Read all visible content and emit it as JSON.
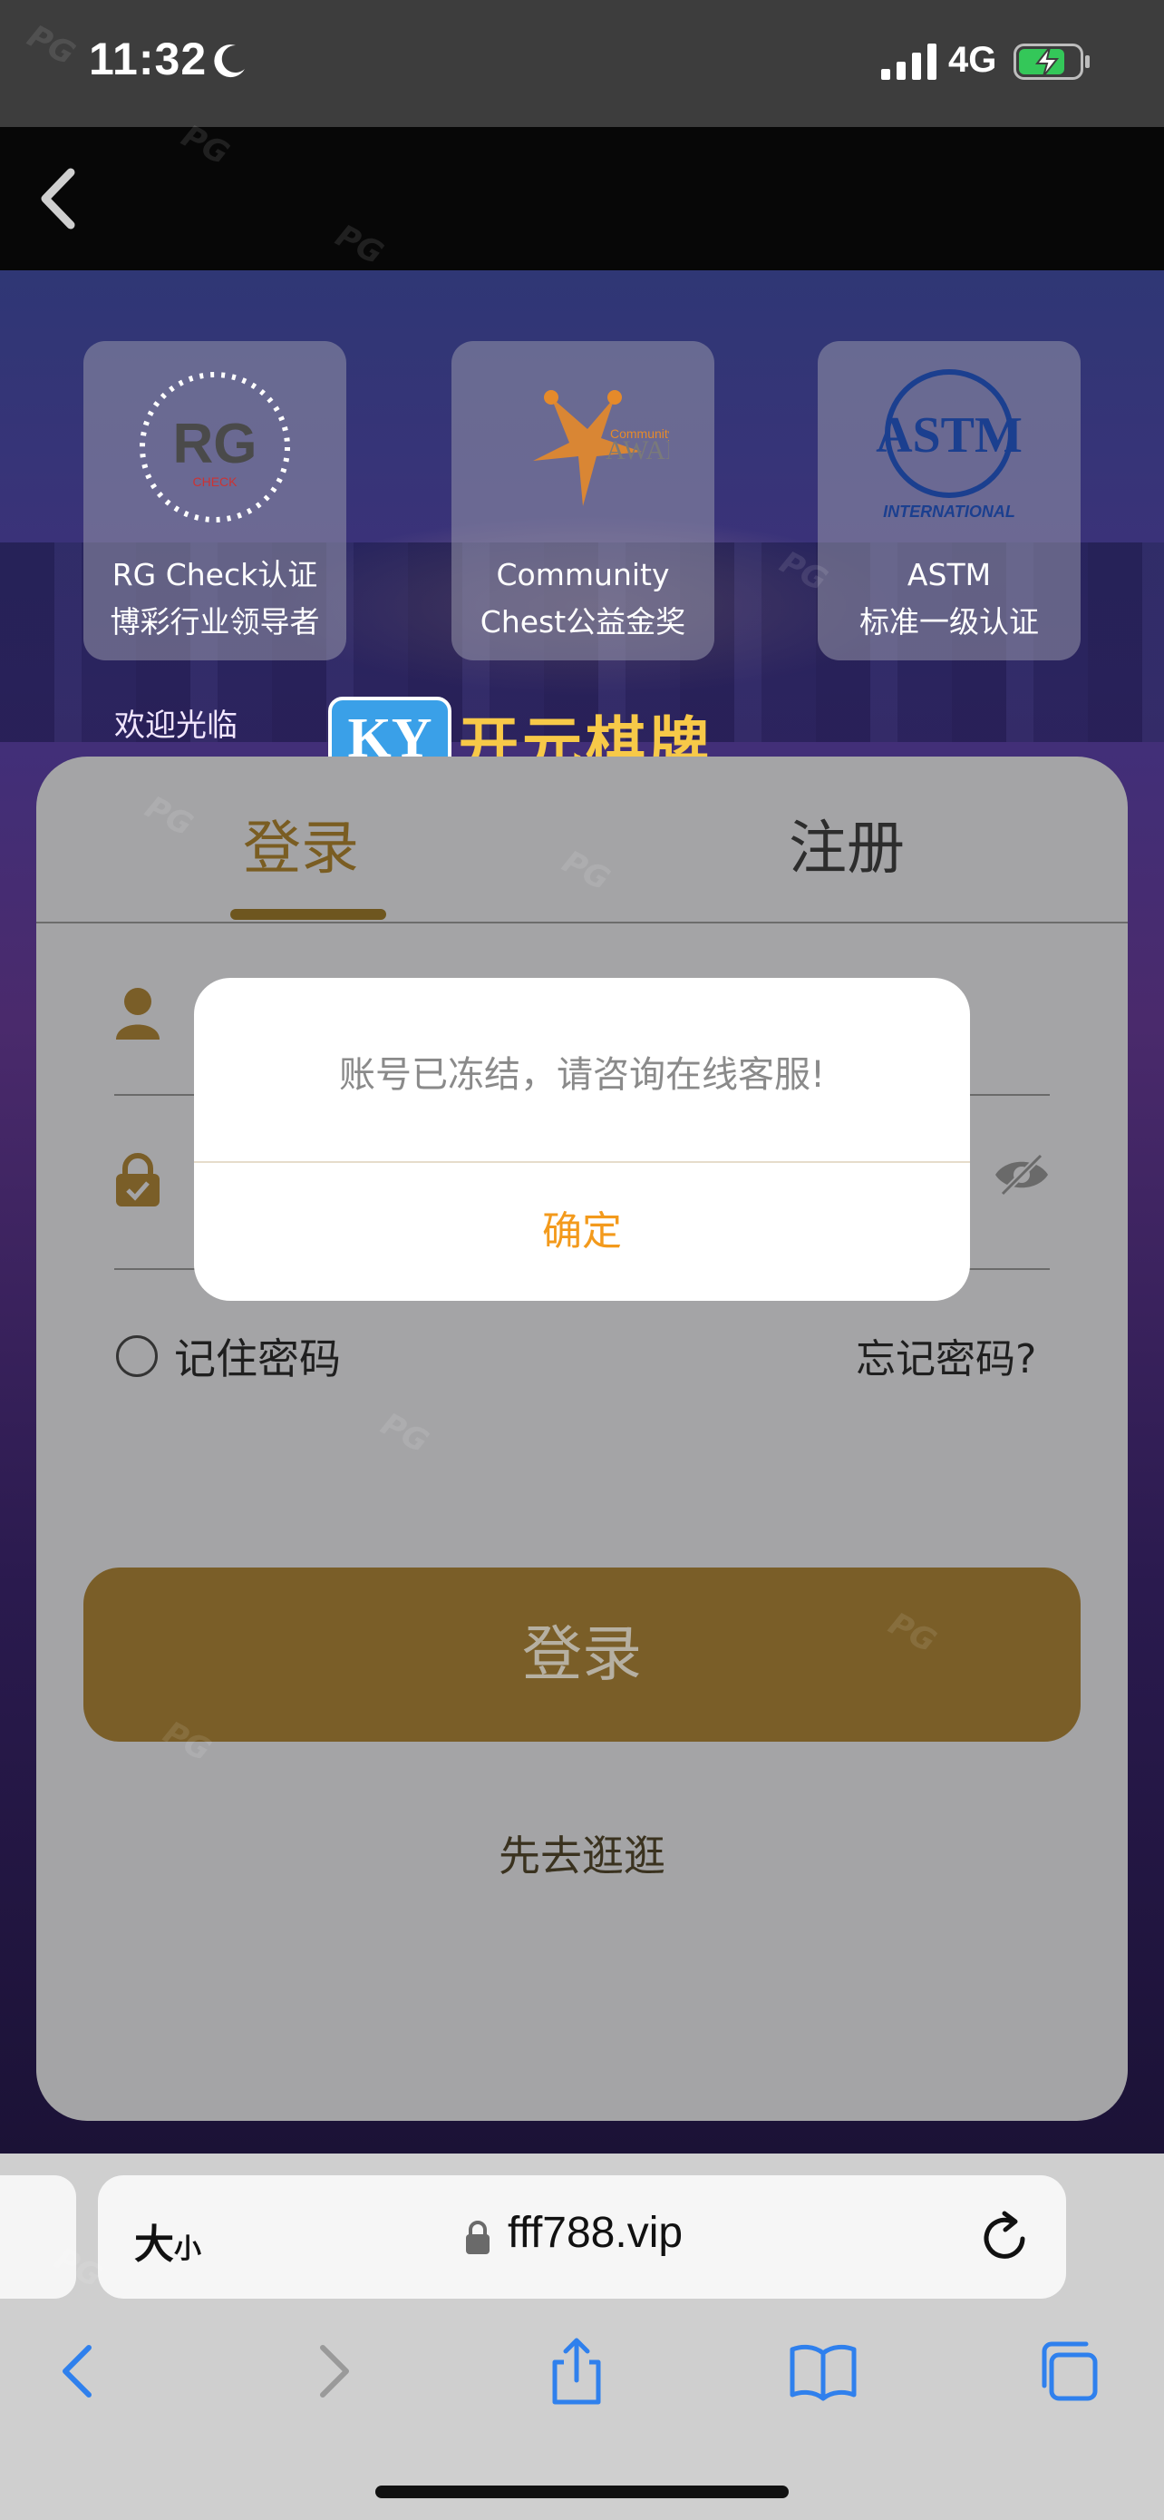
{
  "status_bar": {
    "time": "11:32",
    "network": "4G"
  },
  "badges": [
    {
      "logo_text": "RG",
      "logo_sub": "CHECK",
      "line1": "RG Check认证",
      "line2": "博彩行业领导者"
    },
    {
      "logo_text": "Community Chest",
      "logo_sub": "AWARD",
      "line1": "Community",
      "line2": "Chest公益金奖"
    },
    {
      "logo_text": "ASTM",
      "logo_sub": "INTERNATIONAL",
      "line1": "ASTM",
      "line2": "标准一级认证"
    }
  ],
  "banner": {
    "welcome_cn": "欢迎光临",
    "brand": "开元棋牌",
    "brand_logo": "KY"
  },
  "tabs": {
    "login": "登录",
    "register": "注册"
  },
  "form": {
    "remember_label": "记住密码",
    "forgot_label": "忘记密码?",
    "login_button": "登录",
    "browse_link": "先去逛逛"
  },
  "dialog": {
    "message": "账号已冻结，请咨询在线客服!",
    "ok_label": "确定"
  },
  "browser": {
    "text_size_big": "大",
    "text_size_small": "小",
    "url": "fff788.vip"
  },
  "watermark": "PG",
  "colors": {
    "accent": "#7a5e28",
    "dialog_ok": "#f39a1c",
    "status_bar": "#3d3d3d",
    "battery_fill": "#34c759"
  }
}
